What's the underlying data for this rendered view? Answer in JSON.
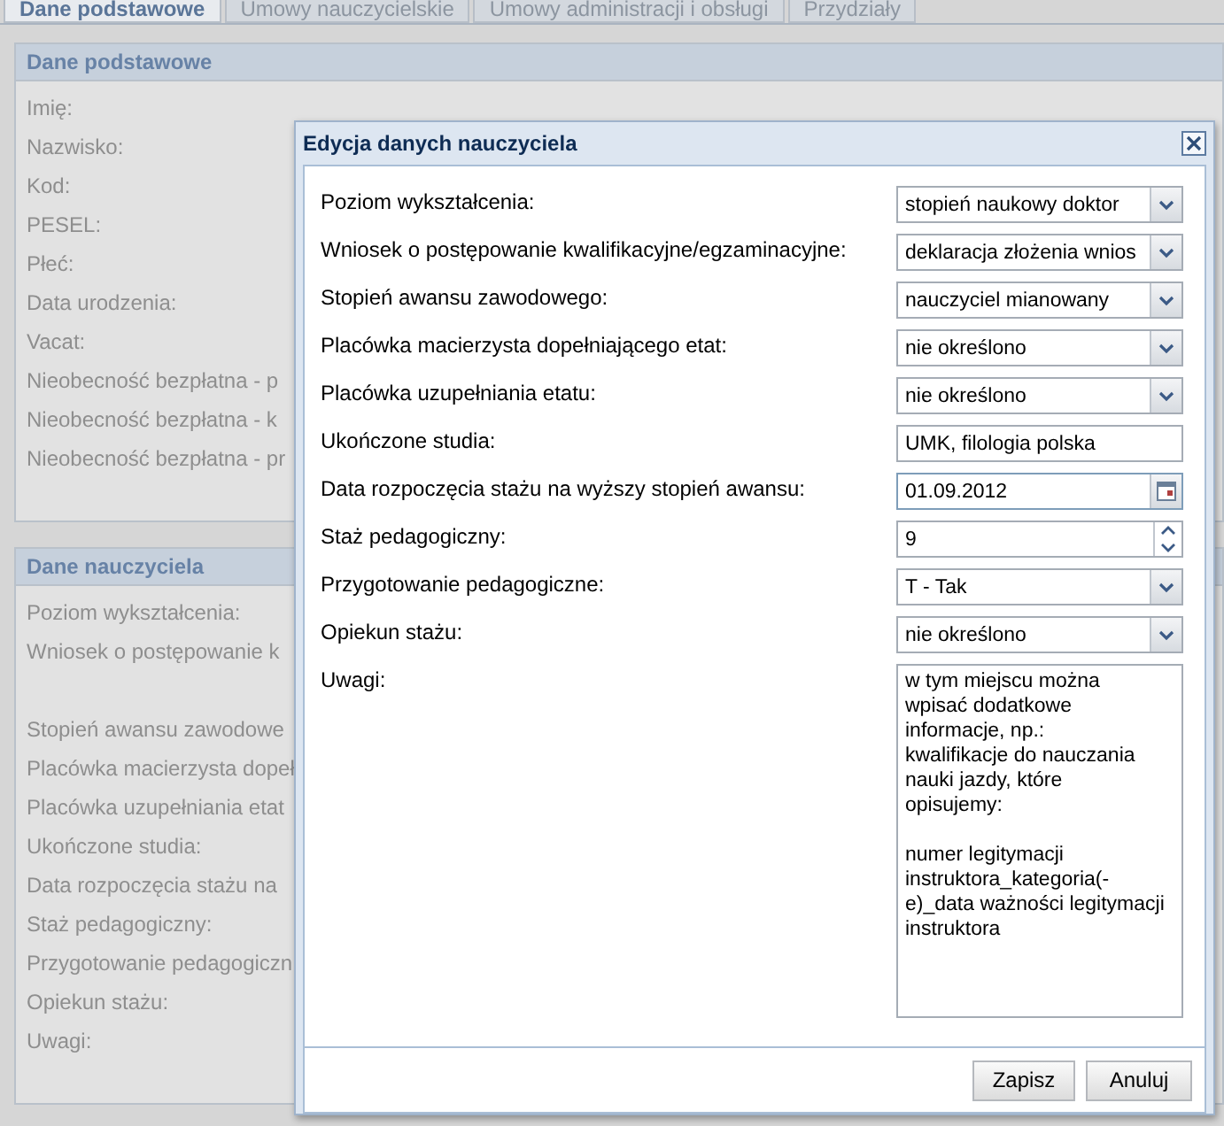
{
  "tabs": [
    {
      "label": "Dane podstawowe",
      "selected": true
    },
    {
      "label": "Umowy nauczycielskie",
      "selected": false
    },
    {
      "label": "Umowy administracji i obsługi",
      "selected": false
    },
    {
      "label": "Przydziały",
      "selected": false
    }
  ],
  "panels": [
    {
      "title": "Dane podstawowe",
      "labels": [
        "Imię:",
        "Nazwisko:",
        "Kod:",
        "PESEL:",
        "Płeć:",
        "Data urodzenia:",
        "Vacat:",
        "Nieobecność bezpłatna - p",
        "Nieobecność bezpłatna - k",
        "Nieobecność bezpłatna - pr"
      ]
    },
    {
      "title": "Dane nauczyciela",
      "labels": [
        "Poziom wykształcenia:",
        "Wniosek o postępowanie k",
        "Stopień awansu zawodowe",
        "Placówka macierzysta dopeł",
        "Placówka uzupełniania etat",
        "Ukończone studia:",
        "Data rozpoczęcia stażu na",
        "Staż pedagogiczny:",
        "Przygotowanie pedagogiczn",
        "Opiekun stażu:",
        "Uwagi:"
      ]
    }
  ],
  "dialog": {
    "title": "Edycja danych nauczyciela",
    "fields": [
      {
        "label": "Poziom wykształcenia:",
        "kind": "select",
        "value": "stopień naukowy doktor"
      },
      {
        "label": "Wniosek o postępowanie kwalifikacyjne/egzaminacyjne:",
        "kind": "select",
        "value": "deklaracja złożenia wnios"
      },
      {
        "label": "Stopień awansu zawodowego:",
        "kind": "select",
        "value": "nauczyciel mianowany"
      },
      {
        "label": "Placówka macierzysta dopełniającego etat:",
        "kind": "select",
        "value": "nie określono"
      },
      {
        "label": "Placówka uzupełniania etatu:",
        "kind": "select",
        "value": "nie określono"
      },
      {
        "label": "Ukończone studia:",
        "kind": "text",
        "value": "UMK, filologia polska"
      },
      {
        "label": "Data rozpoczęcia stażu na wyższy stopień awansu:",
        "kind": "date",
        "value": "01.09.2012"
      },
      {
        "label": "Staż pedagogiczny:",
        "kind": "spinner",
        "value": "9"
      },
      {
        "label": "Przygotowanie pedagogiczne:",
        "kind": "select",
        "value": "T - Tak"
      },
      {
        "label": "Opiekun stażu:",
        "kind": "select",
        "value": "nie określono"
      },
      {
        "label": "Uwagi:",
        "kind": "textarea",
        "value": "w tym miejscu można\nwpisać dodatkowe\ninformacje, np.:\nkwalifikacje do nauczania\nnauki jazdy, które\nopisujemy:\n\nnumer legitymacji\ninstruktora_kategoria(-e)_data ważności legitymacji\ninstruktora"
      }
    ],
    "buttons": [
      "Zapisz",
      "Anuluj"
    ]
  }
}
